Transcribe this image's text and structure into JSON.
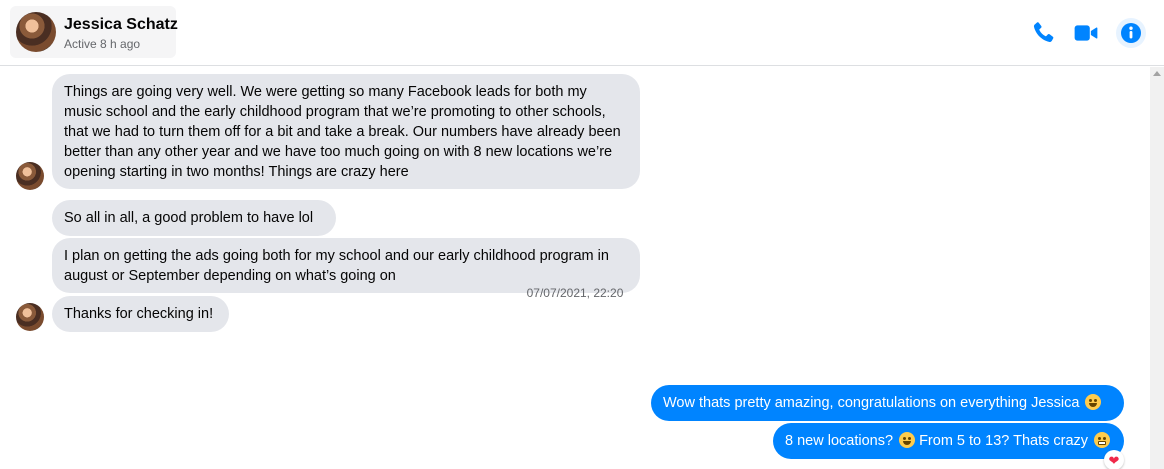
{
  "header": {
    "contact_name": "Jessica Schatz",
    "status": "Active 8 h ago",
    "icons": [
      "phone-icon",
      "video-camera-icon",
      "info-icon"
    ],
    "accent_color": "#0084ff"
  },
  "messages": [
    {
      "direction": "incoming",
      "text": "Things are going very well. We were getting so many Facebook leads for both my music school and the early childhood program that we’re promoting to other schools, that we had to turn them off for a bit and take a break. Our numbers have already been better than any other year and we have too much going on with 8 new locations we’re opening starting in two months! Things are crazy here"
    },
    {
      "direction": "incoming",
      "text": "So all in all, a good problem to have lol"
    },
    {
      "direction": "incoming",
      "text": "I plan on getting the ads going both for my school and our early childhood program in august or September depending on what’s going on"
    },
    {
      "direction": "incoming",
      "text": "Thanks for checking in!"
    },
    {
      "direction": "outgoing",
      "text": "Wow thats pretty amazing, congratulations on everything Jessica",
      "emoji": "slightly-smiling-face"
    },
    {
      "direction": "outgoing",
      "text_a": "8 new locations?",
      "emoji_a": "slightly-smiling-face",
      "text_b": "From 5 to 13? Thats crazy",
      "emoji_b": "grimacing-face",
      "reaction": "heart"
    }
  ],
  "timestamp": "07/07/2021, 22:20"
}
